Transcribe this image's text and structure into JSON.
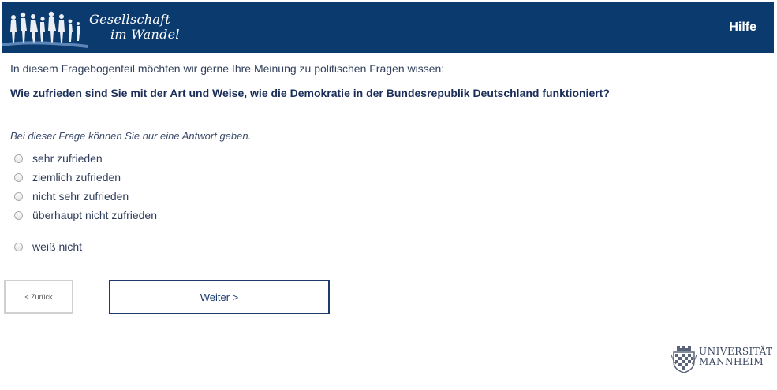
{
  "header": {
    "logo_line1": "Gesellschaft",
    "logo_line2": "im Wandel",
    "help_label": "Hilfe",
    "bg_color": "#0b3a6e"
  },
  "survey": {
    "intro": "In diesem Fragebogenteil möchten wir gerne Ihre Meinung zu politischen Fragen wissen:",
    "question": "Wie zufrieden sind Sie mit der Art und Weise, wie die Demokratie in der Bundesrepublik Deutschland funktioniert?",
    "hint": "Bei dieser Frage können Sie nur eine Antwort geben.",
    "options": [
      {
        "label": "sehr zufrieden",
        "selected": false
      },
      {
        "label": "ziemlich zufrieden",
        "selected": false
      },
      {
        "label": "nicht sehr zufrieden",
        "selected": false
      },
      {
        "label": "überhaupt nicht zufrieden",
        "selected": false
      },
      {
        "label": "weiß nicht",
        "selected": false
      }
    ]
  },
  "nav": {
    "back_label": "< Zurück",
    "next_label": "Weiter >"
  },
  "footer": {
    "university_line1": "UNIVERSITÄT",
    "university_line2": "MANNHEIM",
    "crest_icon": "university-crest-icon"
  }
}
